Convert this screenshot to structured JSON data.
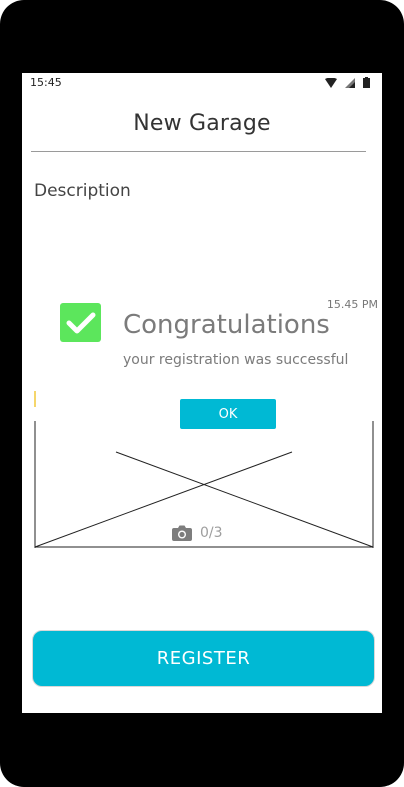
{
  "status_bar": {
    "time": "15:45"
  },
  "header": {
    "title": "New Garage"
  },
  "form": {
    "description_label": "Description"
  },
  "photos": {
    "counter": "0/3"
  },
  "actions": {
    "register_label": "REGISTER"
  },
  "notification": {
    "time": "15.45 PM",
    "title": "Congratulations",
    "message": "your registration was successful",
    "ok_label": "OK"
  },
  "colors": {
    "accent": "#00b9d4",
    "success": "#5ce65c"
  },
  "icons": [
    "wifi-icon",
    "signal-icon",
    "battery-icon",
    "checkmark-icon",
    "camera-icon"
  ]
}
